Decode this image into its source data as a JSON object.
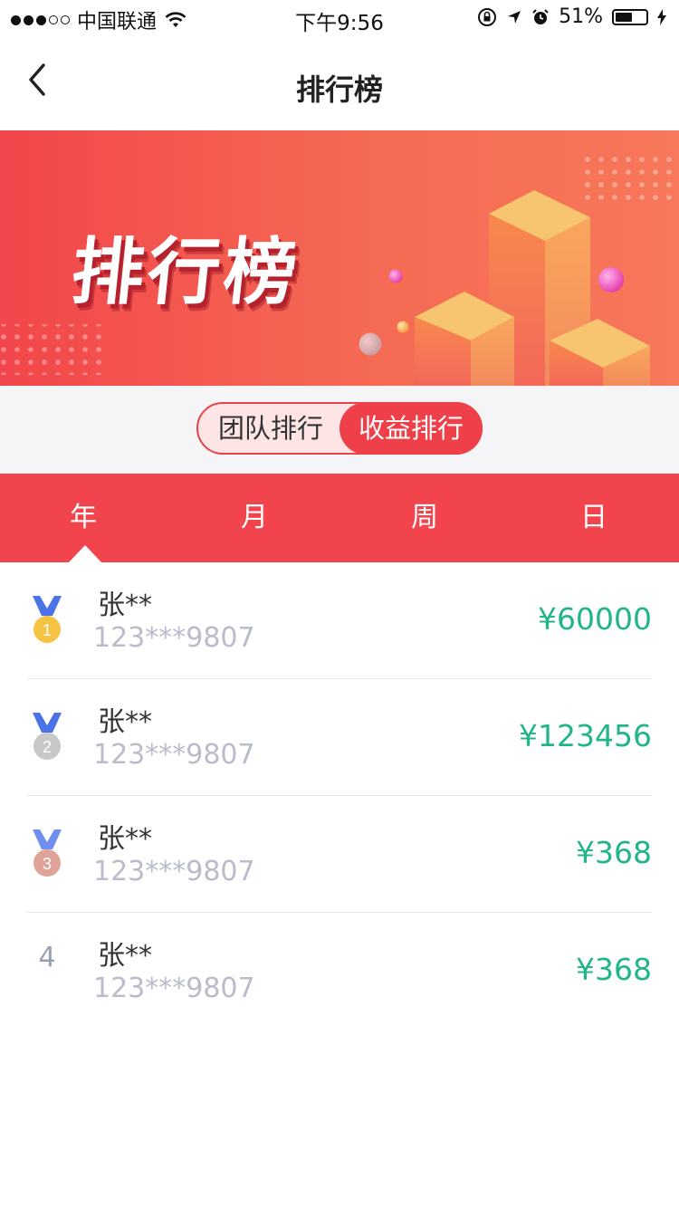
{
  "status_bar": {
    "carrier": "中国联通",
    "time": "下午9:56",
    "battery": "51%"
  },
  "nav": {
    "title": "排行榜"
  },
  "banner": {
    "title": "排行榜"
  },
  "toggle": {
    "team": "团队排行",
    "income": "收益排行",
    "active": "income"
  },
  "period_tabs": [
    "年",
    "月",
    "周",
    "日"
  ],
  "active_period_index": 0,
  "rankings": [
    {
      "rank": "1",
      "name": "张**",
      "phone": "123***9807",
      "amount": "¥60000",
      "medal": "gold-medal-icon",
      "medal_color": "#f7c342"
    },
    {
      "rank": "2",
      "name": "张**",
      "phone": "123***9807",
      "amount": "¥123456",
      "medal": "silver-medal-icon",
      "medal_color": "#c8c8c8"
    },
    {
      "rank": "3",
      "name": "张**",
      "phone": "123***9807",
      "amount": "¥368",
      "medal": "bronze-medal-icon",
      "medal_color": "#dfa497"
    },
    {
      "rank": "4",
      "name": "张**",
      "phone": "123***9807",
      "amount": "¥368",
      "medal": null,
      "medal_color": null
    }
  ],
  "colors": {
    "primary_red": "#f2444c",
    "amount_green": "#22b58c",
    "medal_ribbon": "#4a73e8"
  }
}
